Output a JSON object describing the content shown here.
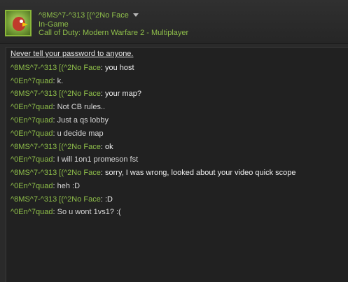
{
  "header": {
    "username": "^8MS^7-^313 [(^2No Face",
    "status": "In-Game",
    "game": "Call of Duty: Modern Warfare 2 - Multiplayer",
    "avatar_icon": "angry-bird-icon",
    "dropdown_icon": "chevron-down-icon"
  },
  "chat": {
    "warning": "Never tell your password to anyone.",
    "messages": [
      {
        "sender": "^8MS^7-^313 [(^2No Face",
        "text": "you host"
      },
      {
        "sender": "^0En^7quad",
        "text": "k."
      },
      {
        "sender": "^8MS^7-^313 [(^2No Face",
        "text": "your map?"
      },
      {
        "sender": "^0En^7quad",
        "text": "Not CB rules.."
      },
      {
        "sender": "^0En^7quad",
        "text": "Just a qs lobby"
      },
      {
        "sender": "^0En^7quad",
        "text": "u decide map"
      },
      {
        "sender": "^8MS^7-^313 [(^2No Face",
        "text": "ok"
      },
      {
        "sender": "^0En^7quad",
        "text": "I will 1on1 promeson fst"
      },
      {
        "sender": "^8MS^7-^313 [(^2No Face",
        "text": "sorry, I was wrong, looked about your video quick scope"
      },
      {
        "sender": "^0En^7quad",
        "text": "heh :D"
      },
      {
        "sender": "^8MS^7-^313 [(^2No Face",
        "text": ":D"
      },
      {
        "sender": "^0En^7quad",
        "text": "So u wont 1vs1? :("
      }
    ]
  }
}
